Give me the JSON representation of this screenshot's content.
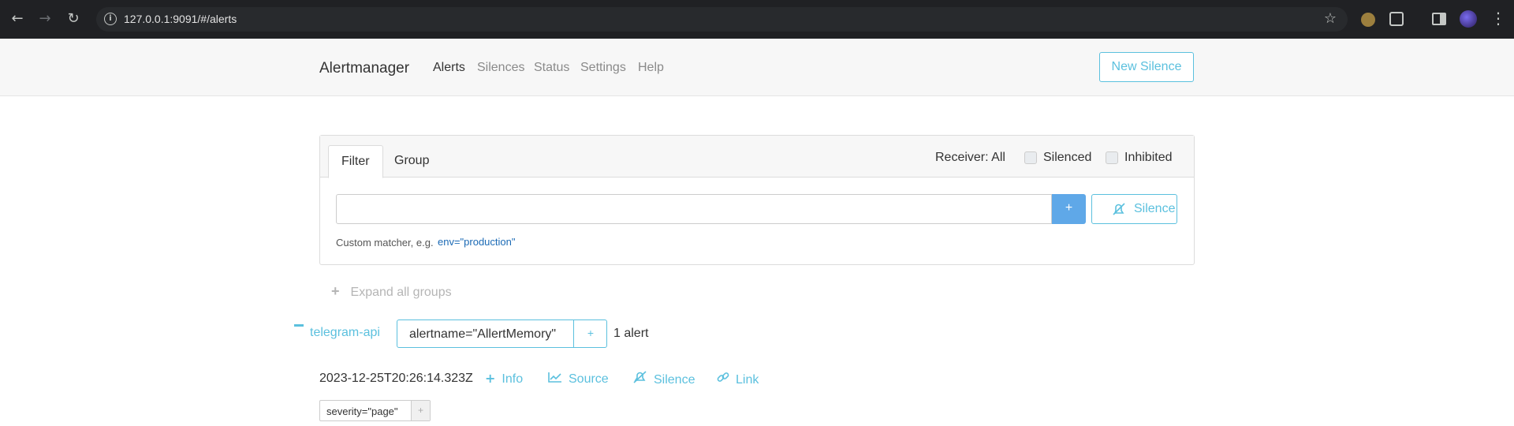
{
  "browser": {
    "url": "127.0.0.1:9091/#/alerts",
    "back_icon": "←",
    "forward_icon": "→",
    "reload_icon": "↻",
    "star_icon": "☆",
    "menu_icon": "⋮"
  },
  "navbar": {
    "brand": "Alertmanager",
    "links": [
      "Alerts",
      "Silences",
      "Status",
      "Settings",
      "Help"
    ],
    "active": "Alerts",
    "new_silence": "New Silence"
  },
  "filter_card": {
    "tabs": [
      "Filter",
      "Group"
    ],
    "active_tab": "Filter",
    "receiver": "Receiver: All",
    "silenced": "Silenced",
    "inhibited": "Inhibited",
    "input_value": "",
    "plus_button": "+",
    "silence_button": "Silence",
    "helper_text": "Custom matcher, e.g.",
    "helper_example": "env=\"production\""
  },
  "expand_all": {
    "icon": "+",
    "label": "Expand all groups"
  },
  "group": {
    "name": "telegram-api",
    "matcher": "alertname=\"AllertMemory\"",
    "matcher_plus": "+",
    "count": "1 alert"
  },
  "alert": {
    "timestamp": "2023-12-25T20:26:14.323Z",
    "actions": {
      "info": "Info",
      "source": "Source",
      "silence": "Silence",
      "link": "Link"
    },
    "labels": [
      {
        "text": "severity=\"page\"",
        "plus": "+"
      }
    ]
  },
  "colors": {
    "accent": "#5bc0de",
    "primary_button": "#5fa8e8",
    "chrome": "#202124"
  }
}
